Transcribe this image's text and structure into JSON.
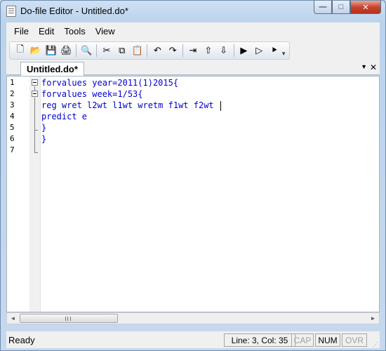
{
  "window": {
    "title": "Do-file Editor - Untitled.do*",
    "controls": {
      "minimize": "—",
      "maximize": "□",
      "close": "✕"
    }
  },
  "menu": [
    "File",
    "Edit",
    "Tools",
    "View"
  ],
  "toolbar": {
    "buttons": [
      {
        "name": "new-file-icon",
        "glyph": "🗋"
      },
      {
        "name": "open-folder-icon",
        "glyph": "📂"
      },
      {
        "name": "save-icon",
        "glyph": "💾"
      },
      {
        "name": "print-icon",
        "glyph": "🖨"
      },
      {
        "name": "find-icon",
        "glyph": "🔍"
      },
      {
        "name": "cut-icon",
        "glyph": "✂"
      },
      {
        "name": "copy-icon",
        "glyph": "⧉"
      },
      {
        "name": "paste-icon",
        "glyph": "📋"
      },
      {
        "name": "undo-icon",
        "glyph": "↶"
      },
      {
        "name": "redo-icon",
        "glyph": "↷"
      },
      {
        "name": "indent-icon",
        "glyph": "⇥"
      },
      {
        "name": "move-up-icon",
        "glyph": "⇧"
      },
      {
        "name": "move-down-icon",
        "glyph": "⇩"
      },
      {
        "name": "do-all-icon",
        "glyph": "▶"
      },
      {
        "name": "execute-icon",
        "glyph": "▷"
      },
      {
        "name": "run-icon",
        "glyph": "⯈"
      }
    ],
    "more": "▾"
  },
  "tab": {
    "label": "Untitled.do*",
    "arrow": "▼",
    "close": "✕"
  },
  "editor": {
    "line_numbers": [
      "1",
      "2",
      "3",
      "4",
      "5",
      "6",
      "7"
    ],
    "lines": [
      "forvalues year=2011(1)2015{",
      "forvalues week=1/53{",
      "reg wret l2wt l1wt wretm f1wt f2wt ",
      "predict e",
      "}",
      "}",
      ""
    ],
    "cursor_line": 3,
    "text_color": "#0000cc"
  },
  "scrollbar": {
    "left": "◄",
    "right": "►"
  },
  "status": {
    "text": "Ready",
    "position": "Line: 3, Col: 35",
    "cap": "CAP",
    "num": "NUM",
    "ovr": "OVR"
  }
}
